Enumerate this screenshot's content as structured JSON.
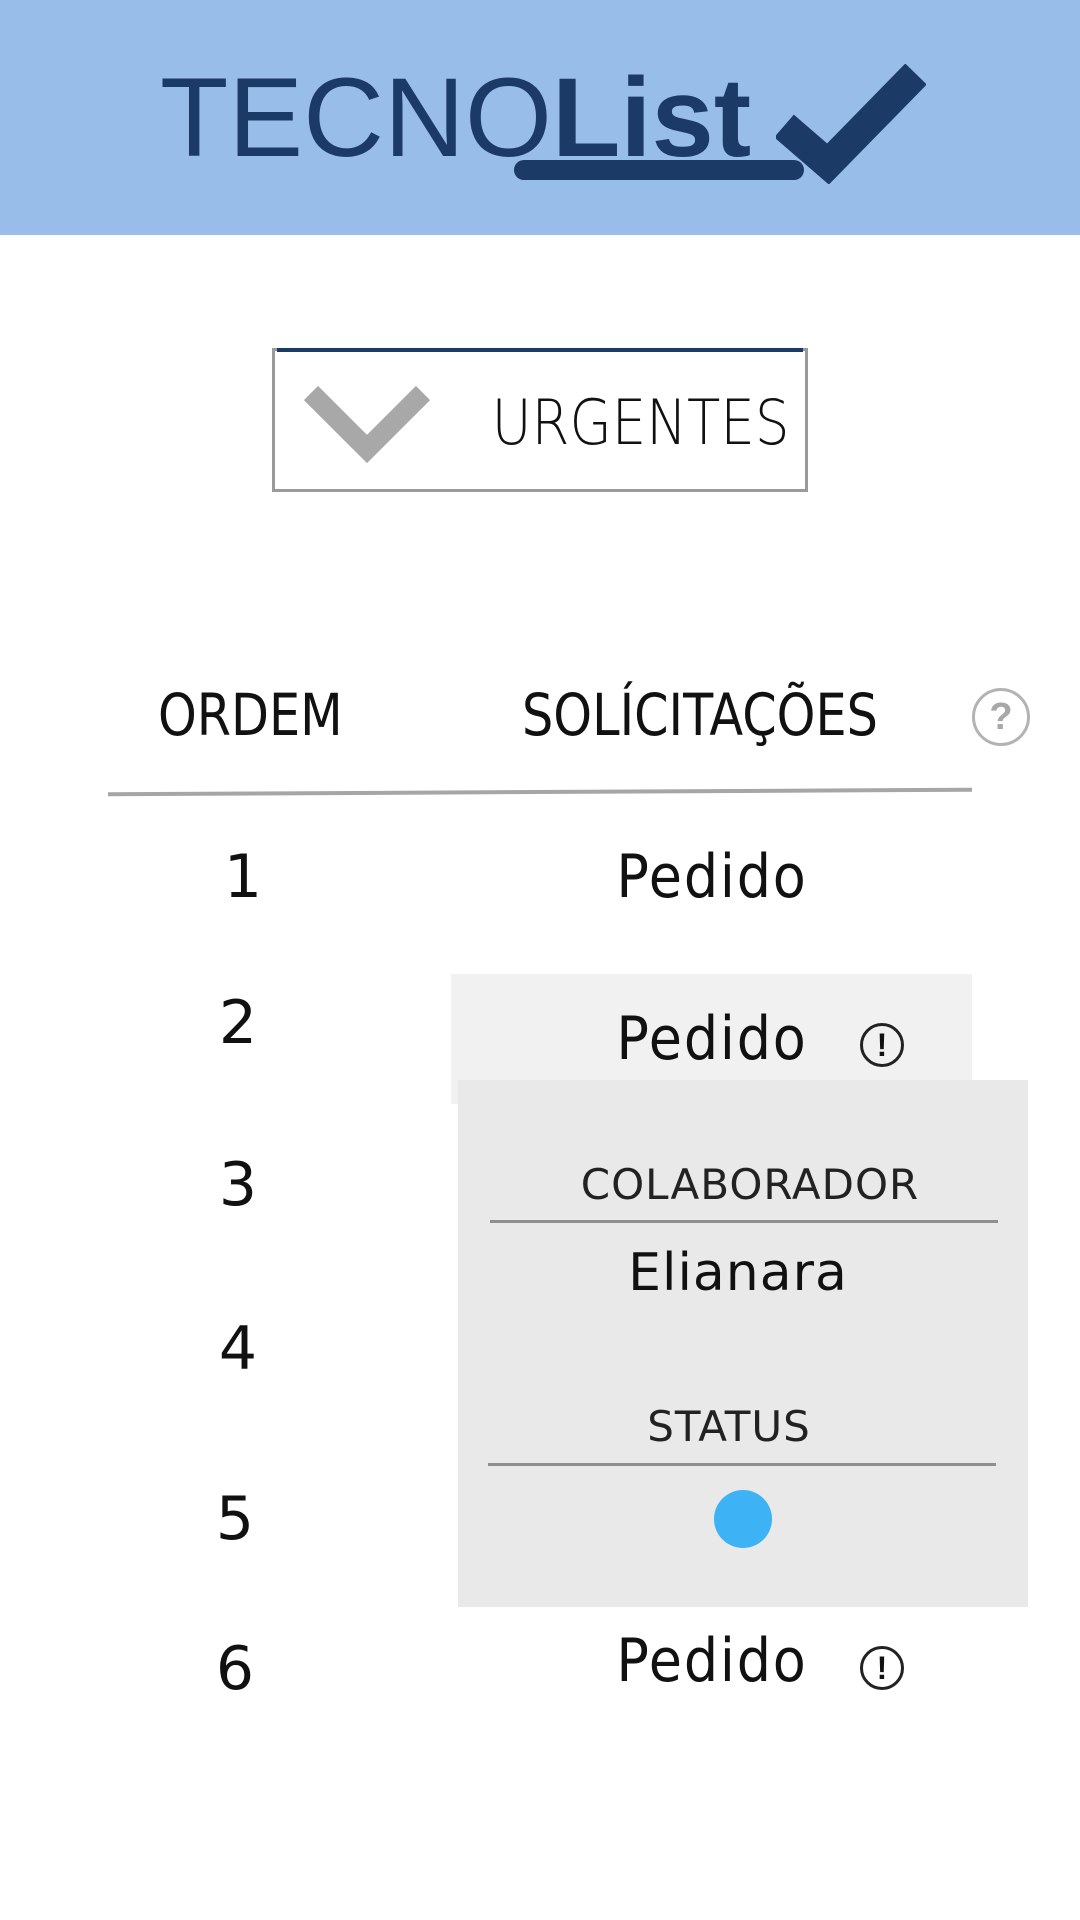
{
  "header": {
    "logo_light": "TECNO",
    "logo_bold": "List",
    "logo_icon": "checkmark-icon",
    "background": "#98bde8",
    "brand_color": "#1b3a66"
  },
  "filter": {
    "selected": "URGENTES",
    "icon": "chevron-down-icon"
  },
  "table": {
    "columns": [
      "ORDEM",
      "SOLÍCITAÇÕES"
    ],
    "help_icon": "?",
    "rows": [
      {
        "order": "1",
        "text": "Pedido",
        "alert": false
      },
      {
        "order": "2",
        "text": "Pedido",
        "alert": true
      },
      {
        "order": "3",
        "text": "",
        "alert": false
      },
      {
        "order": "4",
        "text": "",
        "alert": false
      },
      {
        "order": "5",
        "text": "",
        "alert": false
      },
      {
        "order": "6",
        "text": "Pedido",
        "alert": true
      }
    ],
    "alert_symbol": "!"
  },
  "popover": {
    "collaborator_label": "COLABORADOR",
    "collaborator_value": "Elianara",
    "status_label": "STATUS",
    "status_color": "#3db3f5"
  }
}
